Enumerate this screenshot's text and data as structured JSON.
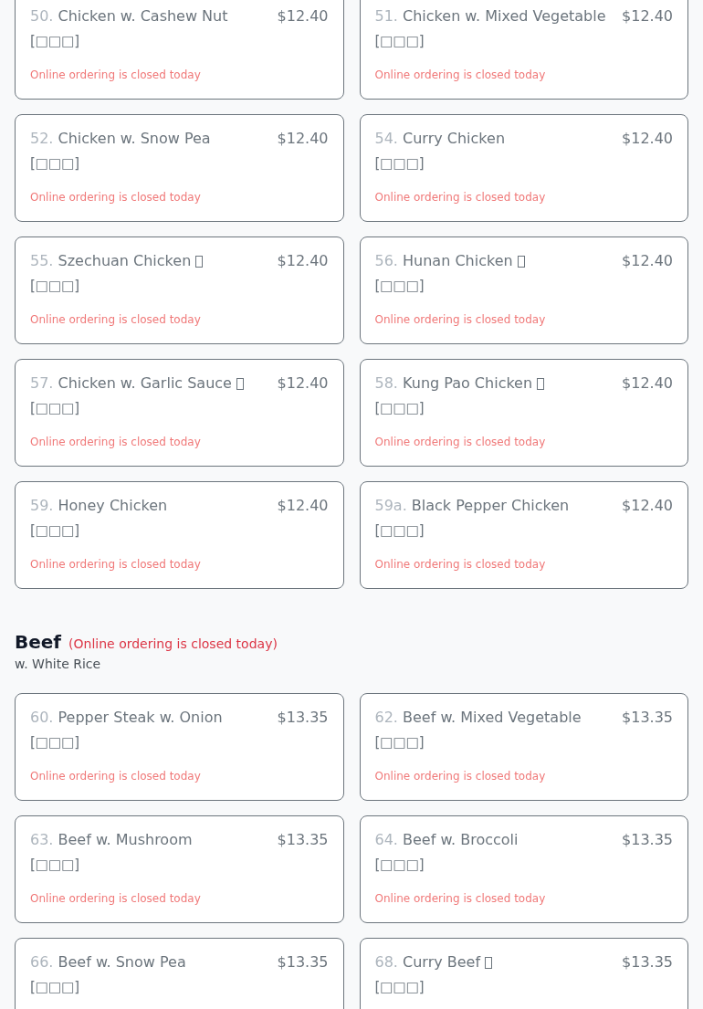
{
  "sections": [
    {
      "items": [
        {
          "number": "50.",
          "name": "Chicken w. Cashew Nut",
          "spicy": false,
          "chinese": "[□□□]",
          "price": "$12.40",
          "status": "Online ordering is closed today"
        },
        {
          "number": "51.",
          "name": "Chicken w. Mixed Vegetable",
          "spicy": false,
          "chinese": "[□□□]",
          "price": "$12.40",
          "status": "Online ordering is closed today"
        },
        {
          "number": "52.",
          "name": "Chicken w. Snow Pea",
          "spicy": false,
          "chinese": "[□□□]",
          "price": "$12.40",
          "status": "Online ordering is closed today"
        },
        {
          "number": "54.",
          "name": "Curry Chicken",
          "spicy": false,
          "chinese": "[□□□]",
          "price": "$12.40",
          "status": "Online ordering is closed today"
        },
        {
          "number": "55.",
          "name": "Szechuan Chicken",
          "spicy": true,
          "chinese": "[□□□]",
          "price": "$12.40",
          "status": "Online ordering is closed today"
        },
        {
          "number": "56.",
          "name": "Hunan Chicken",
          "spicy": true,
          "chinese": "[□□□]",
          "price": "$12.40",
          "status": "Online ordering is closed today"
        },
        {
          "number": "57.",
          "name": "Chicken w. Garlic Sauce",
          "spicy": true,
          "chinese": "[□□□]",
          "price": "$12.40",
          "status": "Online ordering is closed today"
        },
        {
          "number": "58.",
          "name": "Kung Pao Chicken",
          "spicy": true,
          "chinese": "[□□□]",
          "price": "$12.40",
          "status": "Online ordering is closed today"
        },
        {
          "number": "59.",
          "name": "Honey Chicken",
          "spicy": false,
          "chinese": "[□□□]",
          "price": "$12.40",
          "status": "Online ordering is closed today"
        },
        {
          "number": "59a.",
          "name": "Black Pepper Chicken",
          "spicy": false,
          "chinese": "[□□□]",
          "price": "$12.40",
          "status": "Online ordering is closed today"
        }
      ]
    },
    {
      "title": "Beef",
      "note": "(Online ordering is closed today)",
      "subtitle": "w. White Rice",
      "items": [
        {
          "number": "60.",
          "name": "Pepper Steak w. Onion",
          "spicy": false,
          "chinese": "[□□□]",
          "price": "$13.35",
          "status": "Online ordering is closed today"
        },
        {
          "number": "62.",
          "name": "Beef w. Mixed Vegetable",
          "spicy": false,
          "chinese": "[□□□]",
          "price": "$13.35",
          "status": "Online ordering is closed today"
        },
        {
          "number": "63.",
          "name": "Beef w. Mushroom",
          "spicy": false,
          "chinese": "[□□□]",
          "price": "$13.35",
          "status": "Online ordering is closed today"
        },
        {
          "number": "64.",
          "name": "Beef w. Broccoli",
          "spicy": false,
          "chinese": "[□□□]",
          "price": "$13.35",
          "status": "Online ordering is closed today"
        },
        {
          "number": "66.",
          "name": "Beef w. Snow Pea",
          "spicy": false,
          "chinese": "[□□□]",
          "price": "$13.35"
        },
        {
          "number": "68.",
          "name": "Curry Beef",
          "spicy": true,
          "chinese": "[□□□]",
          "price": "$13.35"
        }
      ]
    }
  ]
}
